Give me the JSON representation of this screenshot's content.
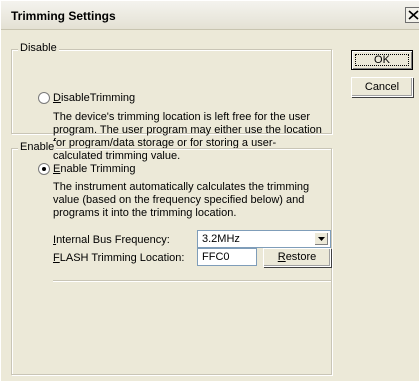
{
  "window": {
    "title": "Trimming Settings"
  },
  "disable_group": {
    "legend": "Disable",
    "radio_label": "DisableTrimming",
    "radio_accel": "D",
    "radio_rest": "isableTrimming",
    "selected": false,
    "description": "The device's trimming location is left free for the user program. The user program may either use the location for program/data storage or for storing a user-calculated trimming value."
  },
  "enable_group": {
    "legend": "Enable",
    "radio_label": "Enable Trimming",
    "radio_accel": "E",
    "radio_rest": "nable Trimming",
    "selected": true,
    "description": "The instrument automatically calculates the trimming value (based on the frequency specified below) and programs it into the trimming location.",
    "bus_freq_label_accel": "I",
    "bus_freq_label_rest": "nternal Bus Frequency:",
    "bus_freq_value": "3.2MHz",
    "flash_label_accel": "F",
    "flash_label_rest": "LASH Trimming Location:",
    "flash_value": "FFC0",
    "restore_accel": "R",
    "restore_rest": "estore"
  },
  "buttons": {
    "ok": "OK",
    "cancel": "Cancel"
  },
  "icons": {
    "close": "close-icon",
    "dropdown": "chevron-down-icon"
  }
}
